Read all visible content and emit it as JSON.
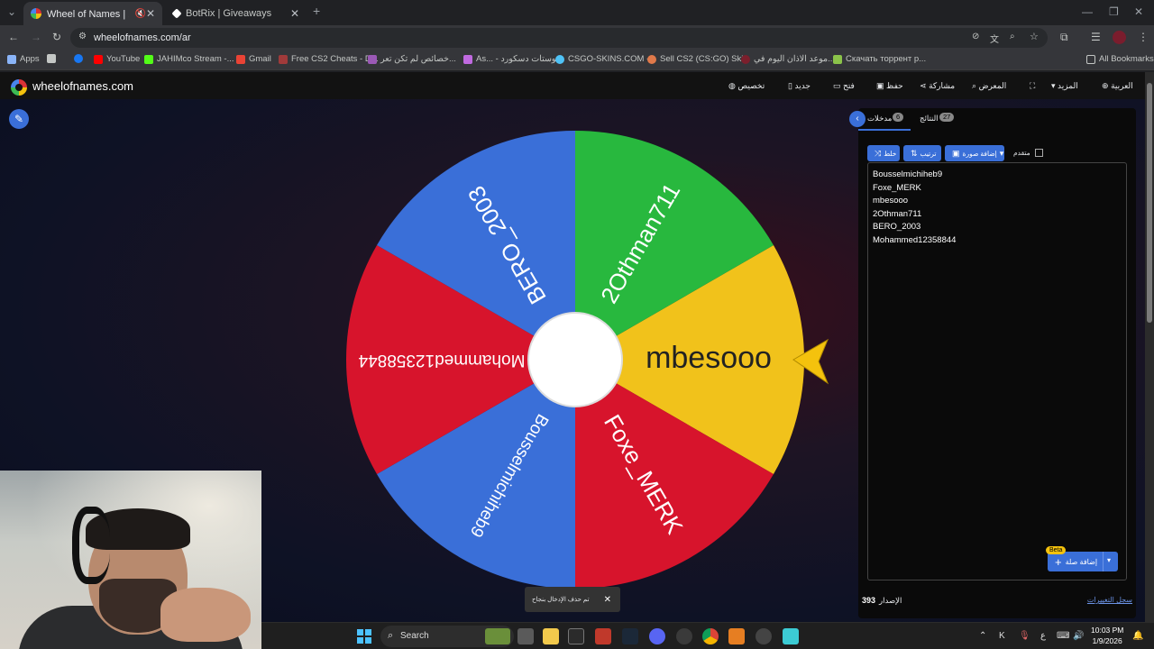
{
  "tabs": [
    {
      "title": "Wheel of Names | العشوائي",
      "active": true
    },
    {
      "title": "BotRix | Giveaways",
      "active": false
    }
  ],
  "address": {
    "url": "wheelofnames.com/ar"
  },
  "bookmarks": [
    {
      "label": "Apps",
      "color": "#8ab4f8"
    },
    {
      "label": "",
      "color": "#c4c7c5"
    },
    {
      "label": "",
      "color": "#1877f2"
    },
    {
      "label": "YouTube",
      "color": "#ff0000"
    },
    {
      "label": "JAHIMco Stream -...",
      "color": "#53fc18"
    },
    {
      "label": "Gmail",
      "color": "#ea4335"
    },
    {
      "label": "Free CS2 Cheats - D...",
      "color": "#a03a3a"
    },
    {
      "label": "خصائص لم تكن تعر...",
      "color": "#9b59b6"
    },
    {
      "label": "As... - بوستات دسكورد",
      "color": "#c06ae0"
    },
    {
      "label": "CSGO-SKINS.COM -...",
      "color": "#4fc3f7"
    },
    {
      "label": "Sell CS2 (CS:GO) Ski...",
      "color": "#e0794a"
    },
    {
      "label": "موعد الاذان اليوم في...",
      "color": "#7b1f2c"
    },
    {
      "label": "Скачать торрент р...",
      "color": "#8bc34a"
    },
    {
      "label": "All Bookmarks",
      "color": "#c4c7c5"
    }
  ],
  "site": {
    "name": "wheelofnames.com",
    "menu": [
      {
        "label": "العربية",
        "icon": "globe-icon"
      },
      {
        "label": "المزيد",
        "icon": "chevron-down-icon"
      },
      {
        "label": "",
        "icon": "fullscreen-icon"
      },
      {
        "label": "المعرض",
        "icon": "search-icon"
      },
      {
        "label": "مشاركة",
        "icon": "share-icon"
      },
      {
        "label": "حفظ",
        "icon": "save-icon"
      },
      {
        "label": "فتح",
        "icon": "folder-icon"
      },
      {
        "label": "جديد",
        "icon": "file-icon"
      },
      {
        "label": "تخصيص",
        "icon": "palette-icon"
      }
    ]
  },
  "wheel": {
    "center_color": "#ffffff",
    "pointer_color": "#f4c20d",
    "segments": [
      {
        "name": "mbesooo",
        "color": "#f1c21b"
      },
      {
        "name": "Foxe_MERK",
        "color": "#d7142c"
      },
      {
        "name": "Bousselmichiheb9",
        "color": "#3a6fd8"
      },
      {
        "name": "Mohammed12358844",
        "color": "#d7142c"
      },
      {
        "name": "BERO_2003",
        "color": "#3a6fd8"
      },
      {
        "name": "2Othman711",
        "color": "#28b83e"
      }
    ]
  },
  "panel": {
    "tabs": [
      {
        "label": "مدخلات",
        "count": "6"
      },
      {
        "label": "النتائج",
        "count": "27"
      }
    ],
    "buttons": [
      {
        "label": "خلط",
        "icon": "shuffle-icon"
      },
      {
        "label": "ترتيب",
        "icon": "sort-icon"
      },
      {
        "label": "إضافة صورة",
        "icon": "image-icon"
      }
    ],
    "advanced_label": "متقدم",
    "entries": [
      "Bousselmichiheb9",
      "Foxe_MERK",
      "mbesooo",
      "2Othman711",
      "BERO_2003",
      "Mohammed12358844"
    ],
    "add_image_label": "إضافة صلة",
    "beta_label": "Beta",
    "version_label": "الإصدار",
    "version_number": "393",
    "changelog_label": "سجل التغييرات"
  },
  "toast": {
    "text": "تم حذف الإدخال بنجاح"
  },
  "taskbar": {
    "search_placeholder": "Search",
    "time": "10:03 PM",
    "date": "1/9/2026",
    "lang": "ع"
  }
}
